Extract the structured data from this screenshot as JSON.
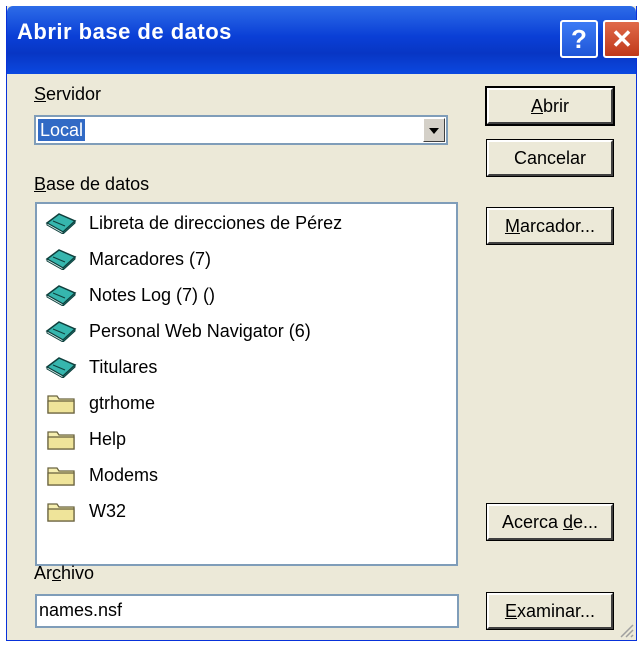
{
  "window": {
    "title": "Abrir base de datos",
    "help_label": "?",
    "close_label": "✕"
  },
  "server": {
    "label_u": "S",
    "label_rest": "ervidor",
    "value": "Local"
  },
  "database": {
    "label_u": "B",
    "label_rest": "ase de datos",
    "items": [
      {
        "label": "Libreta de direcciones de Pérez",
        "icon": "database-book-icon"
      },
      {
        "label": "Marcadores (7)",
        "icon": "database-book-icon"
      },
      {
        "label": "Notes Log (7) ()",
        "icon": "database-book-icon"
      },
      {
        "label": "Personal Web Navigator (6)",
        "icon": "database-book-icon"
      },
      {
        "label": "Titulares",
        "icon": "database-book-icon"
      },
      {
        "label": "gtrhome",
        "icon": "folder-icon"
      },
      {
        "label": "Help",
        "icon": "folder-icon"
      },
      {
        "label": "Modems",
        "icon": "folder-icon"
      },
      {
        "label": "W32",
        "icon": "folder-icon"
      }
    ]
  },
  "file": {
    "label_pre": "Ar",
    "label_u": "c",
    "label_post": "hivo",
    "value": "names.nsf"
  },
  "buttons": {
    "open_u": "A",
    "open_rest": "brir",
    "cancel": "Cancelar",
    "bookmark_u": "M",
    "bookmark_rest": "arcador...",
    "about_pre": "Acerca ",
    "about_u": "d",
    "about_post": "e...",
    "browse_u": "E",
    "browse_rest": "xaminar..."
  },
  "colors": {
    "titlebar": "#0a3fd6",
    "selection": "#316ac5",
    "dialog_bg": "#ece9d8",
    "book_icon": "#2aa7a0",
    "folder_icon": "#f2eaa8"
  }
}
